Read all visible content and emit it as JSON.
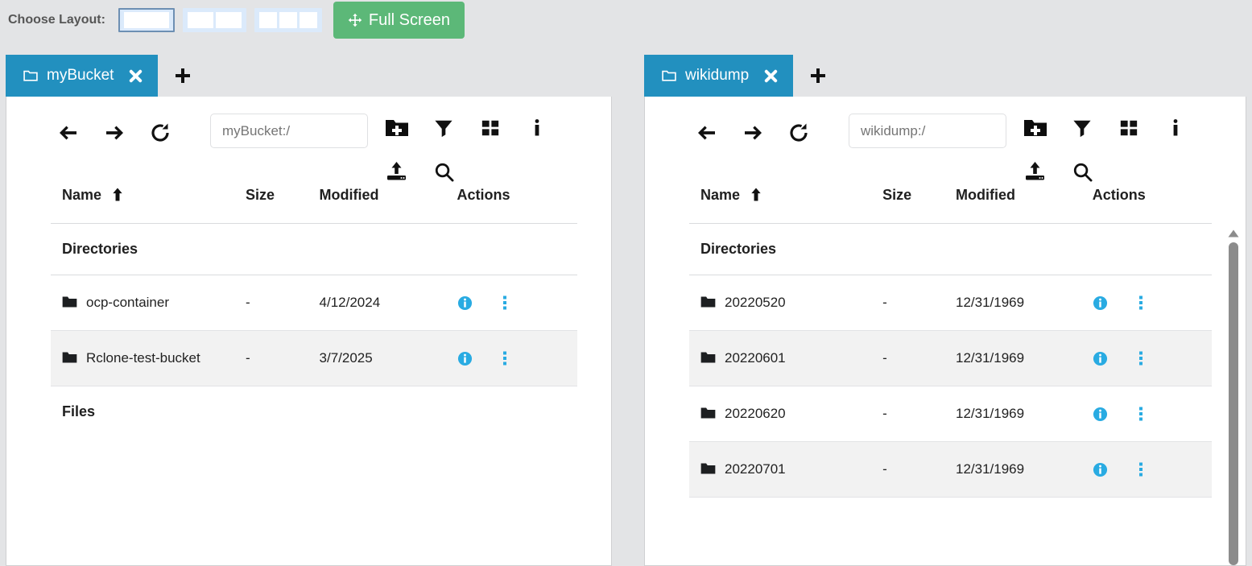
{
  "layout_bar": {
    "label": "Choose Layout:",
    "options": [
      {
        "name": "single-pane",
        "cells": 1,
        "selected": true
      },
      {
        "name": "two-pane",
        "cells": 2,
        "selected": false
      },
      {
        "name": "three-pane",
        "cells": 3,
        "selected": false
      }
    ],
    "fullscreen_label": "Full Screen",
    "fullscreen_color": "#5cb878",
    "fullscreen_icon": "arrows-alt-icon"
  },
  "colors": {
    "tab_active": "#2290bf",
    "accent_blue": "#29abe2",
    "page_background": "#e3e4e6",
    "panel_background": "#ffffff",
    "row_alt_background": "#f2f2f2"
  },
  "toolbar_icons": [
    {
      "name": "back-arrow-icon"
    },
    {
      "name": "forward-arrow-icon"
    },
    {
      "name": "refresh-icon"
    },
    {
      "name": "new-folder-icon"
    },
    {
      "name": "filter-icon"
    },
    {
      "name": "grid-view-icon"
    },
    {
      "name": "info-icon"
    },
    {
      "name": "upload-icon"
    },
    {
      "name": "search-icon"
    }
  ],
  "panels": [
    {
      "tab": {
        "label": "myBucket",
        "folder_icon": "folder-outline-icon",
        "close_icon": "close-x-icon",
        "active": true
      },
      "add_tab_label": "+",
      "path": {
        "value": "",
        "placeholder": "myBucket:/"
      },
      "table": {
        "columns": [
          "Name",
          "Size",
          "Modified",
          "Actions"
        ],
        "sort_column": "Name",
        "sort_direction": "asc",
        "sections": [
          {
            "title": "Directories",
            "rows": [
              {
                "name": "ocp-container",
                "size": "-",
                "modified": "4/12/2024"
              },
              {
                "name": "Rclone-test-bucket",
                "size": "-",
                "modified": "3/7/2025"
              }
            ]
          },
          {
            "title": "Files",
            "rows": []
          }
        ]
      },
      "scrollbar": false
    },
    {
      "tab": {
        "label": "wikidump",
        "folder_icon": "folder-outline-icon",
        "close_icon": "close-x-icon",
        "active": true
      },
      "add_tab_label": "+",
      "path": {
        "value": "",
        "placeholder": "wikidump:/"
      },
      "table": {
        "columns": [
          "Name",
          "Size",
          "Modified",
          "Actions"
        ],
        "sort_column": "Name",
        "sort_direction": "asc",
        "sections": [
          {
            "title": "Directories",
            "rows": [
              {
                "name": "20220520",
                "size": "-",
                "modified": "12/31/1969"
              },
              {
                "name": "20220601",
                "size": "-",
                "modified": "12/31/1969"
              },
              {
                "name": "20220620",
                "size": "-",
                "modified": "12/31/1969"
              },
              {
                "name": "20220701",
                "size": "-",
                "modified": "12/31/1969"
              }
            ]
          }
        ]
      },
      "scrollbar": true
    }
  ]
}
